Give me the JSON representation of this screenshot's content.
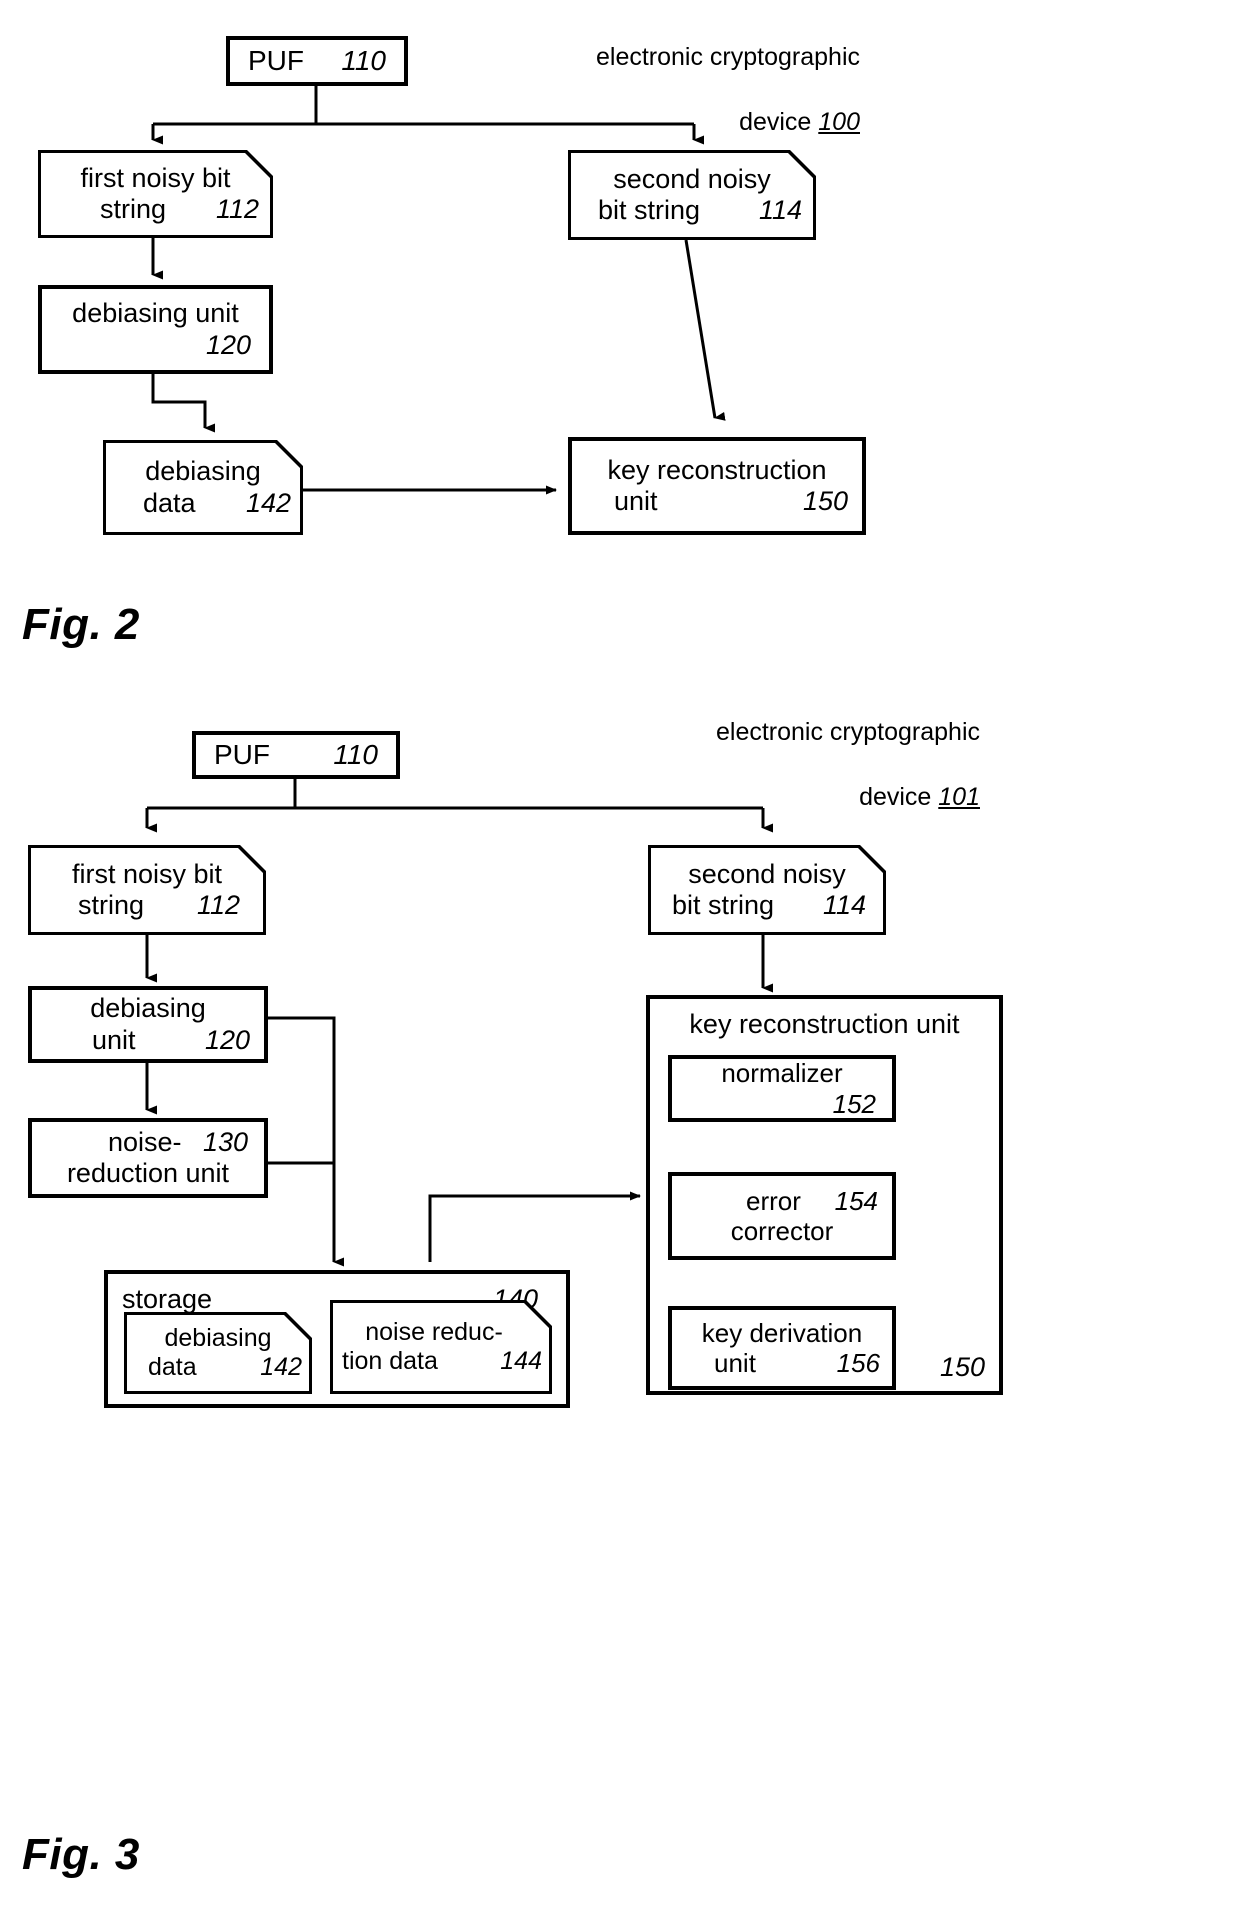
{
  "figures": [
    {
      "id": "fig2",
      "caption_line1": "electronic cryptographic",
      "caption_line2_prefix": "device ",
      "caption_ref": "100",
      "fig_label": "Fig. 2",
      "nodes": {
        "puf": {
          "label": "PUF",
          "ref": "110"
        },
        "first_noisy": {
          "line1": "first noisy bit",
          "line2": "string",
          "ref": "112"
        },
        "second_noisy": {
          "line1": "second noisy",
          "line2": "bit string",
          "ref": "114"
        },
        "debiasing_unit": {
          "line1": "debiasing unit",
          "ref": "120"
        },
        "debiasing_data": {
          "line1": "debiasing",
          "line2": "data",
          "ref": "142"
        },
        "key_reconstruction": {
          "line1": "key reconstruction",
          "line2": "unit",
          "ref": "150"
        }
      }
    },
    {
      "id": "fig3",
      "caption_line1": "electronic cryptographic",
      "caption_line2_prefix": "device ",
      "caption_ref": "101",
      "fig_label": "Fig. 3",
      "nodes": {
        "puf": {
          "label": "PUF",
          "ref": "110"
        },
        "first_noisy": {
          "line1": "first noisy bit",
          "line2": "string",
          "ref": "112"
        },
        "second_noisy": {
          "line1": "second noisy",
          "line2": "bit string",
          "ref": "114"
        },
        "debiasing_unit": {
          "line1": "debiasing",
          "line2": "unit",
          "ref": "120"
        },
        "noise_reduction_unit": {
          "line1": "noise-",
          "line2": "reduction unit",
          "ref": "130"
        },
        "storage": {
          "label": "storage",
          "ref": "140"
        },
        "debiasing_data": {
          "line1": "debiasing",
          "line2": "data",
          "ref": "142"
        },
        "noise_reduction_data": {
          "line1": "noise reduc-",
          "line2": "tion data",
          "ref": "144"
        },
        "key_reconstruction": {
          "label": "key reconstruction unit",
          "ref": "150"
        },
        "normalizer": {
          "label": "normalizer",
          "ref": "152"
        },
        "error_corrector": {
          "line1": "error",
          "line2": "corrector",
          "ref": "154"
        },
        "key_derivation": {
          "line1": "key derivation",
          "line2": "unit",
          "ref": "156"
        }
      }
    }
  ],
  "colors": {
    "stroke": "#000000",
    "background": "#ffffff"
  }
}
